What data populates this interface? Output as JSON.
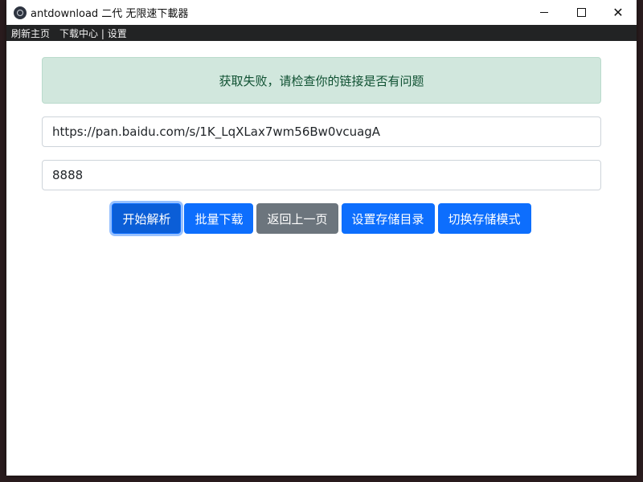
{
  "window": {
    "title": "antdownload 二代 无限速下載器",
    "controls": {
      "minimize": "minimize-icon",
      "maximize": "maximize-icon",
      "close": "✕"
    }
  },
  "menu": {
    "items": [
      "刷新主页",
      "下载中心 | 设置"
    ]
  },
  "alert": {
    "text": "获取失败，请检查你的链接是否有问题",
    "color": "#d1e7dd"
  },
  "form": {
    "url_value": "https://pan.baidu.com/s/1K_LqXLax7wm56Bw0vcuagA",
    "code_value": "8888"
  },
  "buttons": {
    "parse": "开始解析",
    "batch_download": "批量下载",
    "back": "返回上一页",
    "set_storage_dir": "设置存储目录",
    "switch_storage_mode": "切换存储模式"
  },
  "colors": {
    "primary": "#0d6efd",
    "secondary": "#6c757d",
    "menubar": "#222324"
  }
}
